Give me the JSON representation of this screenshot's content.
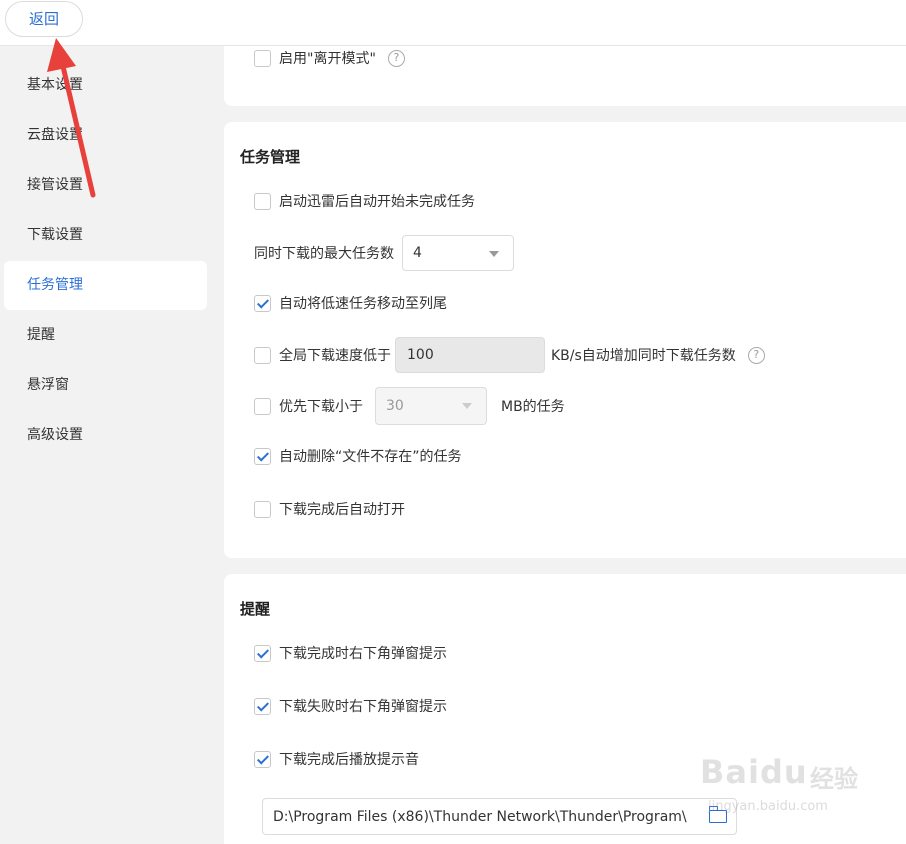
{
  "back_button": "返回",
  "sidebar": {
    "items": [
      {
        "label": "基本设置"
      },
      {
        "label": "云盘设置"
      },
      {
        "label": "接管设置"
      },
      {
        "label": "下载设置"
      },
      {
        "label": "任务管理",
        "active": true
      },
      {
        "label": "提醒"
      },
      {
        "label": "悬浮窗"
      },
      {
        "label": "高级设置"
      }
    ]
  },
  "top_section": {
    "away_mode": {
      "label": "启用\"离开模式\"",
      "checked": false,
      "help_icon": "?"
    }
  },
  "task_management": {
    "title": "任务管理",
    "auto_start": {
      "label": "启动迅雷后自动开始未完成任务",
      "checked": false
    },
    "max_tasks": {
      "label": "同时下载的最大任务数",
      "value": "4"
    },
    "move_slow": {
      "label": "自动将低速任务移动至列尾",
      "checked": true
    },
    "speed_low": {
      "label": "全局下载速度低于",
      "value": "100",
      "suffix": "KB/s自动增加同时下载任务数",
      "checked": false,
      "help_icon": "?"
    },
    "prefer_small": {
      "label": "优先下载小于",
      "value": "30",
      "suffix": "MB的任务",
      "checked": false
    },
    "delete_missing": {
      "label": "自动删除“文件不存在”的任务",
      "checked": true
    },
    "auto_open": {
      "label": "下载完成后自动打开",
      "checked": false
    }
  },
  "reminder": {
    "title": "提醒",
    "complete_popup": {
      "label": "下载完成时右下角弹窗提示",
      "checked": true
    },
    "fail_popup": {
      "label": "下载失败时右下角弹窗提示",
      "checked": true
    },
    "complete_sound": {
      "label": "下载完成后播放提示音",
      "checked": true
    },
    "sound_path": "D:\\Program Files (x86)\\Thunder Network\\Thunder\\Program\\"
  },
  "watermark": {
    "brand": "Baidu",
    "sub": "经验",
    "url": "jingyan.baidu.com"
  },
  "colors": {
    "accent": "#2b6fd6",
    "annotation_arrow": "#e8403a"
  }
}
